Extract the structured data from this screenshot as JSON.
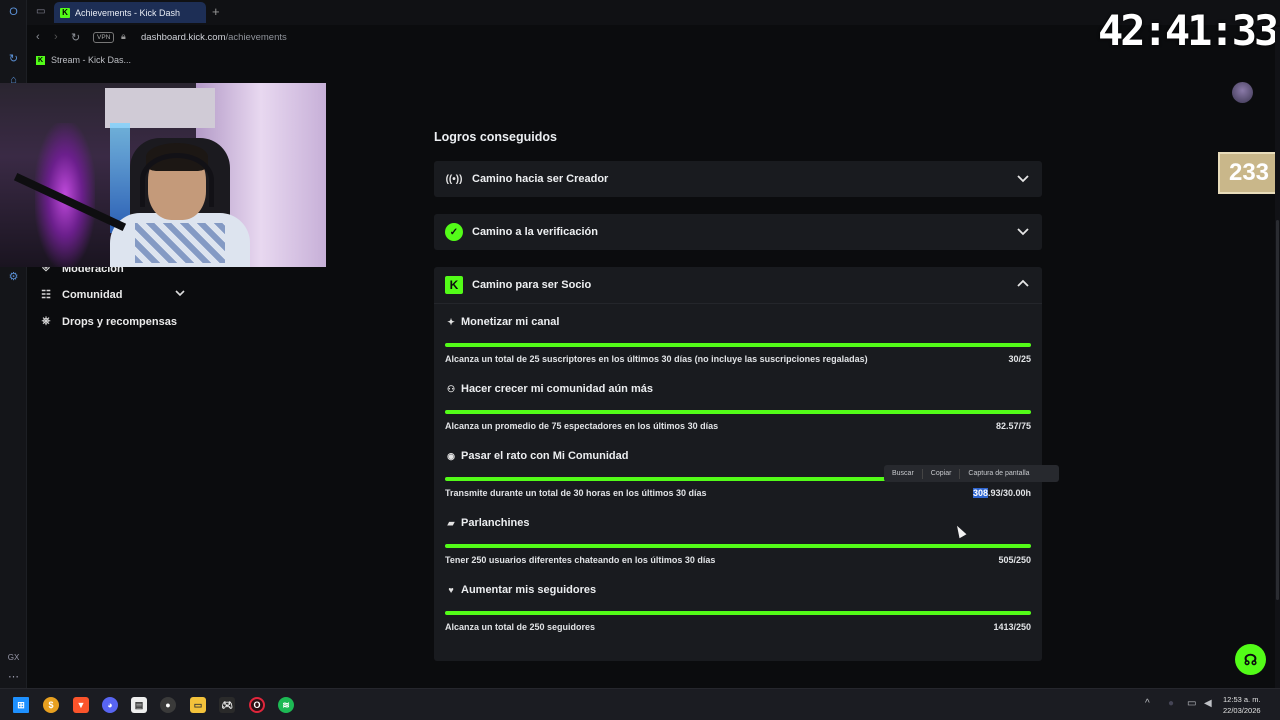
{
  "browser": {
    "tab_title": "Achievements - Kick Dash",
    "url_host": "dashboard.kick.com",
    "url_path": "/achievements",
    "vpn_label": "VPN",
    "bookmark_label": "Stream - Kick Das..."
  },
  "sidebar": {
    "items": [
      {
        "label": "Moderación",
        "icon": "shield-icon"
      },
      {
        "label": "Comunidad",
        "icon": "people-icon"
      },
      {
        "label": "Drops y recompensas",
        "icon": "gift-icon"
      }
    ]
  },
  "main": {
    "section_title": "Logros conseguidos",
    "accordions": [
      {
        "label": "Camino hacia ser Creador",
        "icon": "broadcast-icon",
        "expanded": false
      },
      {
        "label": "Camino a la verificación",
        "icon": "verified-badge-icon",
        "expanded": false
      },
      {
        "label": "Camino para ser Socio",
        "icon": "kick-logo-icon",
        "expanded": true
      }
    ],
    "goals": [
      {
        "title": "Monetizar mi canal",
        "icon": "sparkle-icon",
        "description": "Alcanza un total de 25 suscriptores en los últimos 30 días (no incluye las suscripciones regaladas)",
        "value": "30/25",
        "progress": 1.0
      },
      {
        "title": "Hacer crecer mi comunidad aún más",
        "icon": "group-icon",
        "description": "Alcanza un promedio de 75 espectadores en los últimos 30 días",
        "value": "82.57/75",
        "progress": 1.0
      },
      {
        "title": "Pasar el rato con Mi Comunidad",
        "icon": "broadcast-icon",
        "description": "Transmite durante un total de 30 horas en los últimos 30 días",
        "value_selected": "308",
        "value_rest": ".93/30.00h",
        "progress": 1.0
      },
      {
        "title": "Parlanchines",
        "icon": "chat-icon",
        "description": "Tener 250 usuarios diferentes chateando en los últimos 30 días",
        "value": "505/250",
        "progress": 1.0
      },
      {
        "title": "Aumentar mis seguidores",
        "icon": "heart-icon",
        "description": "Alcanza un total de 250 seguidores",
        "value": "1413/250",
        "progress": 1.0
      }
    ]
  },
  "context_menu": {
    "items": [
      "Buscar",
      "Copiar",
      "Captura de pantalla"
    ]
  },
  "overlay": {
    "timer": "42:41:33",
    "counter": "233"
  },
  "taskbar": {
    "time": "12:53 a. m.",
    "date": "22/03/2026"
  },
  "colors": {
    "accent": "#53fc18",
    "background": "#0b0c0e",
    "card": "#191b1f"
  }
}
